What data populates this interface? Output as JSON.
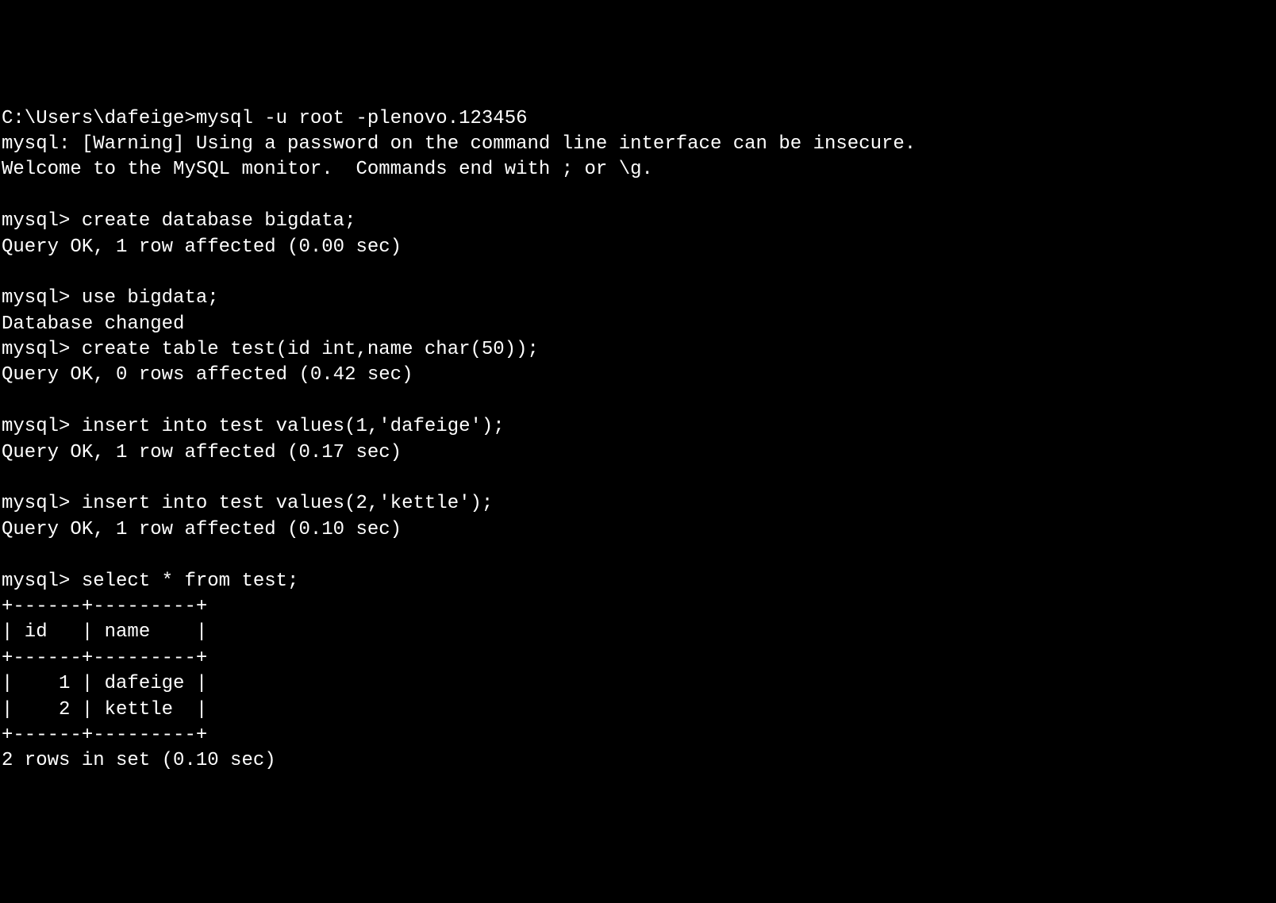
{
  "terminal": {
    "lines": [
      "C:\\Users\\dafeige>mysql -u root -plenovo.123456",
      "mysql: [Warning] Using a password on the command line interface can be insecure.",
      "Welcome to the MySQL monitor.  Commands end with ; or \\g.",
      "",
      "mysql> create database bigdata;",
      "Query OK, 1 row affected (0.00 sec)",
      "",
      "mysql> use bigdata;",
      "Database changed",
      "mysql> create table test(id int,name char(50));",
      "Query OK, 0 rows affected (0.42 sec)",
      "",
      "mysql> insert into test values(1,'dafeige');",
      "Query OK, 1 row affected (0.17 sec)",
      "",
      "mysql> insert into test values(2,'kettle');",
      "Query OK, 1 row affected (0.10 sec)",
      "",
      "mysql> select * from test;",
      "+------+---------+",
      "| id   | name    |",
      "+------+---------+",
      "|    1 | dafeige |",
      "|    2 | kettle  |",
      "+------+---------+",
      "2 rows in set (0.10 sec)"
    ]
  }
}
